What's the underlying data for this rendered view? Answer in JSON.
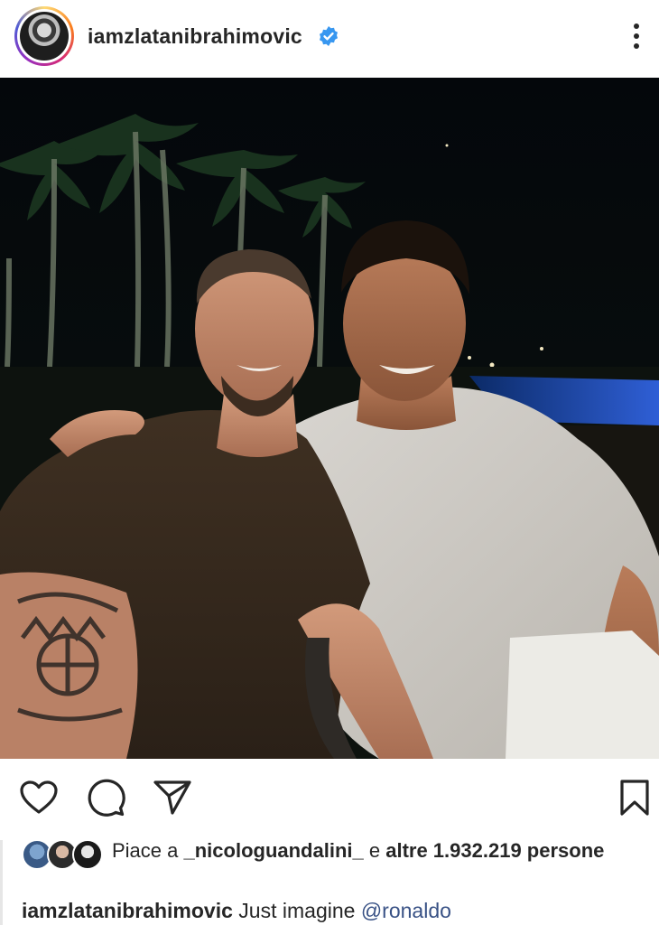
{
  "post": {
    "username": "iamzlatanibrahimovic",
    "verified_icon": "verified-badge-icon",
    "more_icon": "more-vertical-icon"
  },
  "actions": {
    "like_icon": "heart-icon",
    "comment_icon": "comment-icon",
    "share_icon": "send-icon",
    "save_icon": "bookmark-icon"
  },
  "likes": {
    "prefix": "Piace a ",
    "user": "_nicologuandalini_",
    "middle": " e ",
    "others": "altre 1.932.219 persone"
  },
  "caption": {
    "username": "iamzlatanibrahimovic",
    "text": " Just imagine ",
    "mention": "@ronaldo"
  },
  "colors": {
    "accent_blue": "#3897f0",
    "mention": "#385185",
    "text": "#262626"
  }
}
